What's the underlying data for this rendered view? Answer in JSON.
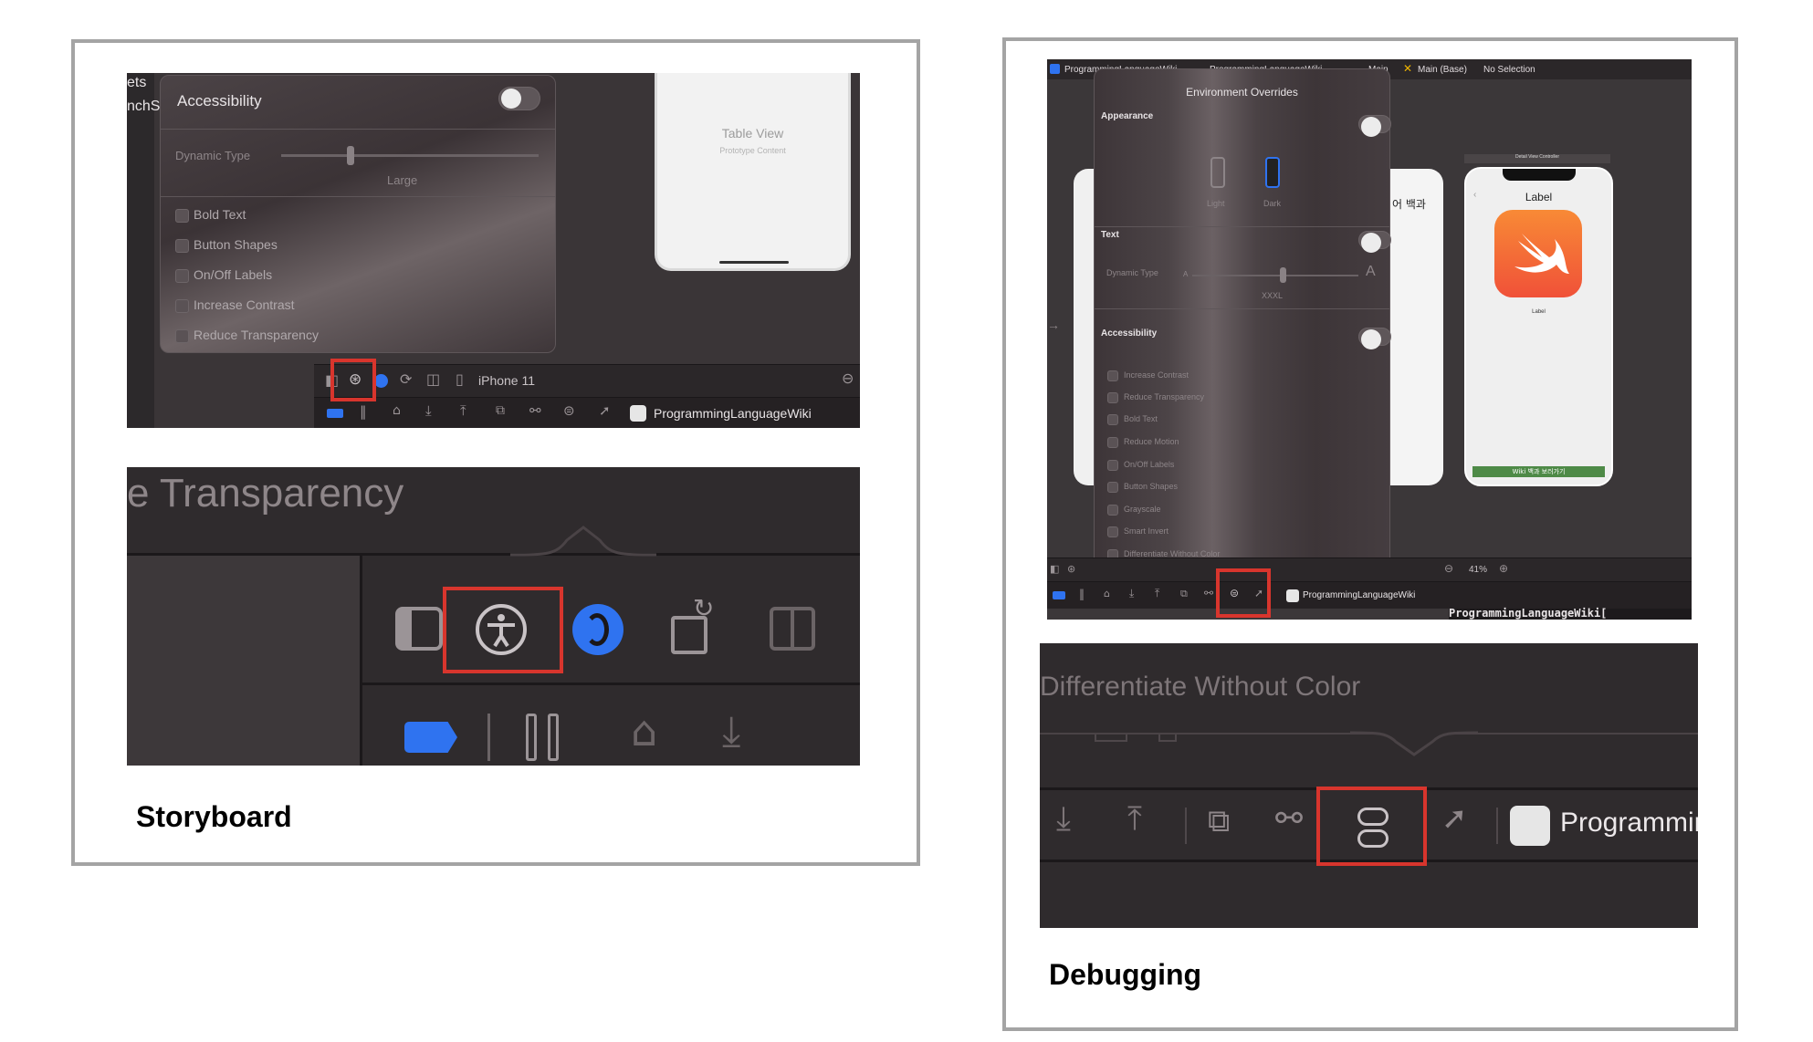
{
  "storyboard": {
    "caption": "Storyboard",
    "left_frag_1": "ets",
    "left_frag_2": "nchS",
    "popover": {
      "title": "Accessibility",
      "dynamic_type_label": "Dynamic Type",
      "dynamic_type_value": "Large",
      "options": [
        "Bold Text",
        "Button Shapes",
        "On/Off Labels",
        "Increase Contrast",
        "Reduce Transparency"
      ]
    },
    "table_view": {
      "title": "Table View",
      "subtitle": "Prototype Content"
    },
    "device": "iPhone 11",
    "project": "ProgrammingLanguageWiki",
    "zoom_text": "e Transparency"
  },
  "debugging": {
    "caption": "Debugging",
    "breadcrumb": [
      "ProgrammingLanguageWiki",
      "ProgrammingLanguageWiki",
      "Main",
      "Main (Base)",
      "No Selection"
    ],
    "popover": {
      "title": "Environment Overrides",
      "appearance": "Appearance",
      "light": "Light",
      "dark": "Dark",
      "text": "Text",
      "dynamic_type": "Dynamic Type",
      "small_a": "A",
      "big_a": "A",
      "dynamic_value": "XXXL",
      "accessibility": "Accessibility",
      "options": [
        "Increase Contrast",
        "Reduce Transparency",
        "Bold Text",
        "Reduce Motion",
        "On/Off Labels",
        "Button Shapes",
        "Grayscale",
        "Smart Invert",
        "Differentiate Without Color"
      ]
    },
    "korean_frag": "어 백과",
    "detail_header": "Detail View Controller",
    "phone_label_top": "Label",
    "phone_label_small": "Label",
    "wiki_button": "Wiki 백과 보러가기",
    "zoom": "41%",
    "project": "ProgrammingLanguageWiki",
    "console_text": "ProgrammingLanguageWiki[",
    "zoom_text": "Differentiate Without Color",
    "zoom_project": "Programmin"
  },
  "colors": {
    "highlight": "#d8352d",
    "accent_blue": "#2f73f0",
    "swift_orange": "#f05138",
    "wiki_green": "#4e8a47"
  }
}
